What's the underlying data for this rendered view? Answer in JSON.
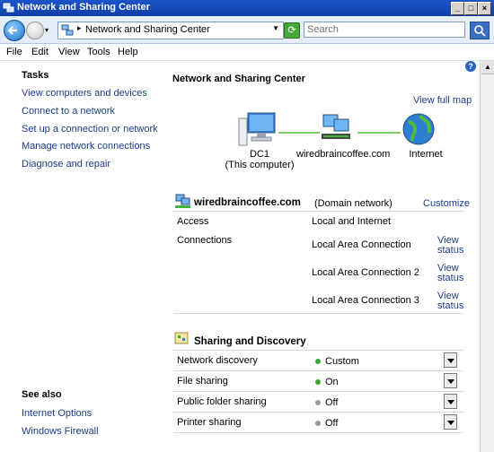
{
  "window": {
    "title": "Network and Sharing Center"
  },
  "address": {
    "path": "Network and Sharing Center",
    "search_placeholder": "Search"
  },
  "menu": [
    "File",
    "Edit",
    "View",
    "Tools",
    "Help"
  ],
  "tasks": {
    "heading": "Tasks",
    "items": [
      "View computers and devices",
      "Connect to a network",
      "Set up a connection or network",
      "Manage network connections",
      "Diagnose and repair"
    ]
  },
  "see_also": {
    "heading": "See also",
    "items": [
      "Internet Options",
      "Windows Firewall"
    ]
  },
  "main": {
    "title": "Network and Sharing Center",
    "view_full_map": "View full map",
    "map": {
      "pc_label": "DC1",
      "pc_sub": "(This computer)",
      "network_label": "wiredbraincoffee.com",
      "internet_label": "Internet"
    },
    "network": {
      "name": "wiredbraincoffee.com",
      "type": "(Domain network)",
      "customize": "Customize",
      "access_label": "Access",
      "access_value": "Local and Internet",
      "connections_label": "Connections",
      "connections": [
        {
          "name": "Local Area Connection",
          "action1": "View",
          "action2": "status"
        },
        {
          "name": "Local Area Connection 2",
          "action1": "View",
          "action2": "status"
        },
        {
          "name": "Local Area Connection 3",
          "action1": "View",
          "action2": "status"
        }
      ]
    },
    "sharing": {
      "heading": "Sharing and Discovery",
      "items": [
        {
          "label": "Network discovery",
          "value": "Custom",
          "status_color": "#3aa63a"
        },
        {
          "label": "File sharing",
          "value": "On",
          "status_color": "#3aa63a"
        },
        {
          "label": "Public folder sharing",
          "value": "Off",
          "status_color": "#9a9a9a"
        },
        {
          "label": "Printer sharing",
          "value": "Off",
          "status_color": "#9a9a9a"
        }
      ]
    }
  }
}
